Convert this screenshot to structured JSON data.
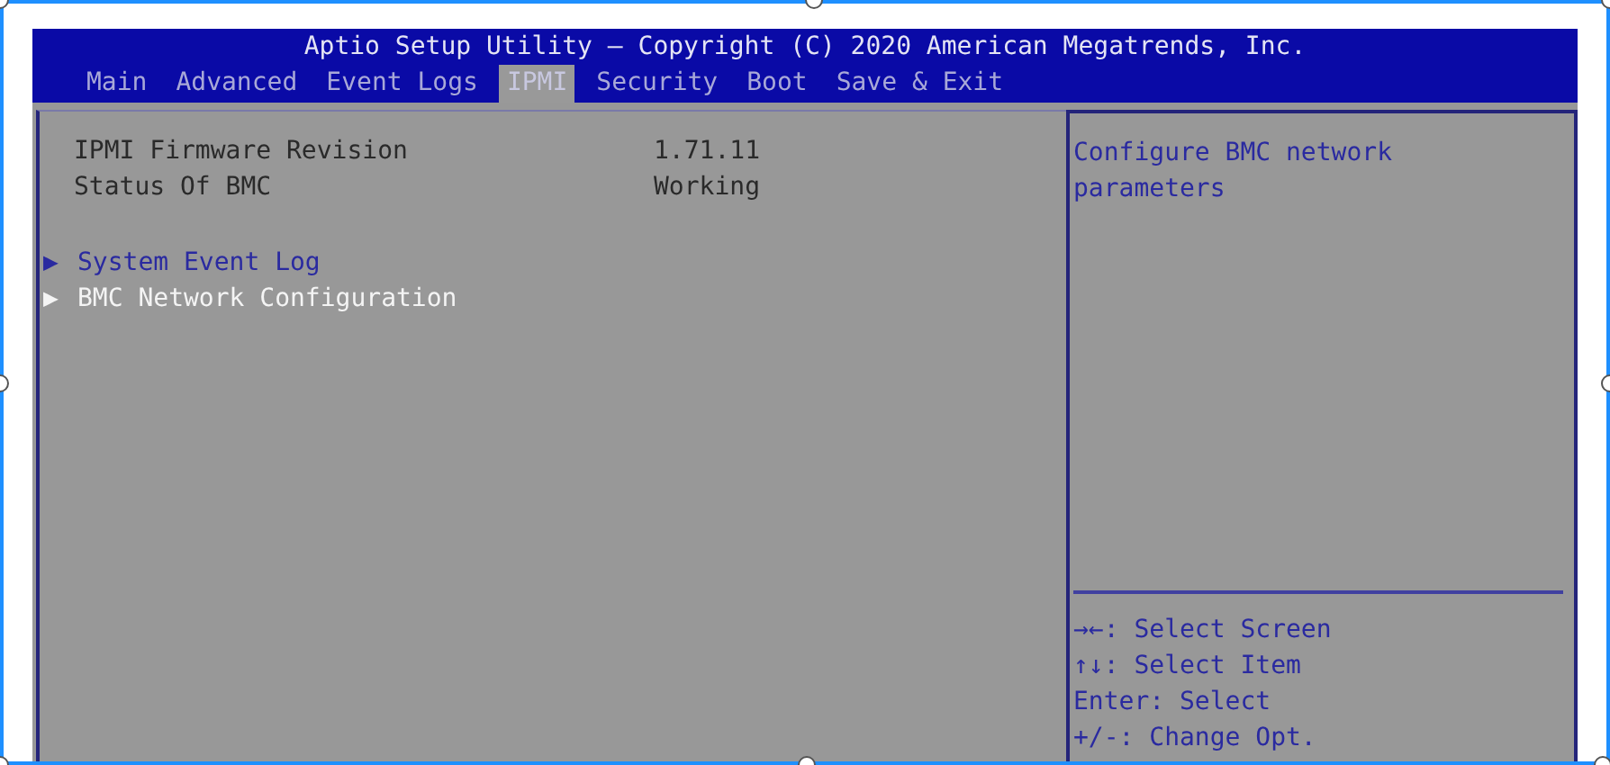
{
  "window": {
    "title": "Aptio Setup Utility – Copyright (C) 2020 American Megatrends, Inc."
  },
  "tabs": [
    {
      "label": "Main",
      "selected": false
    },
    {
      "label": "Advanced",
      "selected": false
    },
    {
      "label": "Event Logs",
      "selected": false
    },
    {
      "label": "IPMI",
      "selected": true
    },
    {
      "label": "Security",
      "selected": false
    },
    {
      "label": "Boot",
      "selected": false
    },
    {
      "label": "Save & Exit",
      "selected": false
    }
  ],
  "info_rows": [
    {
      "label": "IPMI Firmware Revision",
      "value": "1.71.11"
    },
    {
      "label": "Status Of BMC",
      "value": "Working"
    }
  ],
  "submenus": [
    {
      "marker": "▶",
      "label": "System Event Log",
      "selected": false
    },
    {
      "marker": "▶",
      "label": "BMC Network Configuration",
      "selected": true
    }
  ],
  "help": {
    "description": "Configure BMC network parameters",
    "keys": [
      "→←: Select Screen",
      "↑↓: Select Item",
      "Enter: Select",
      "+/-: Change Opt."
    ]
  }
}
